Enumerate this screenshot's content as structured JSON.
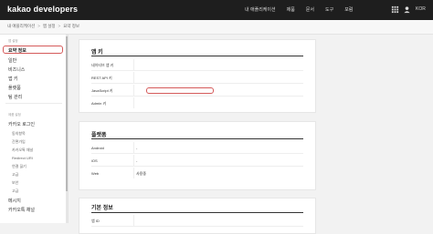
{
  "header": {
    "logo": "kakao developers",
    "nav": [
      "내 애플리케이션",
      "제품",
      "문서",
      "도구",
      "포럼"
    ],
    "lang": "KOR"
  },
  "breadcrumb": [
    "내 애플리케이션",
    "앱 설정",
    "요약 정보"
  ],
  "sidebar": {
    "section1": "앱 설정",
    "items1": [
      "요약 정보",
      "일반",
      "비즈니스",
      "앱 키",
      "플랫폼",
      "팀 관리"
    ],
    "section2": "제품 설정",
    "items2": [
      "카카오 로그인"
    ],
    "subitems": [
      "동의항목",
      "간편가입",
      "카카오톡 채널",
      "Redirect URI",
      "연결 끊기",
      "고급",
      "보안",
      "고급"
    ],
    "items3": [
      "메시지",
      "카카오톡 채널"
    ]
  },
  "app_key_card": {
    "title": "앱 키",
    "rows": [
      {
        "label": "네이티브 앱 키",
        "value": ""
      },
      {
        "label": "REST API 키",
        "value": ""
      },
      {
        "label": "JavaScript 키",
        "value": ""
      },
      {
        "label": "Admin 키",
        "value": ""
      }
    ]
  },
  "platform_card": {
    "title": "플랫폼",
    "rows": [
      {
        "label": "Android",
        "value": "-"
      },
      {
        "label": "iOS",
        "value": "-"
      },
      {
        "label": "Web",
        "value": "사용중"
      }
    ]
  },
  "basic_card": {
    "title": "기본 정보",
    "rows": [
      {
        "label": "앱 ID",
        "value": ""
      }
    ]
  }
}
